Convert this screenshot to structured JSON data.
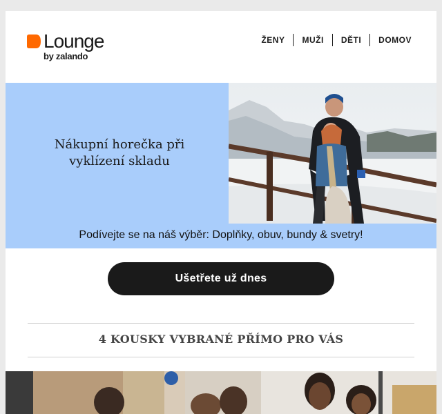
{
  "brand": {
    "name": "Lounge",
    "sub": "by zalando",
    "accent": "#ff6900"
  },
  "nav": {
    "items": [
      "ŽENY",
      "MUŽI",
      "DĚTI",
      "DOMOV"
    ]
  },
  "hero": {
    "headline": "Nákupní horečka při vyklízení skladu",
    "caption": "Podívejte se na náš výběr: Doplňky, obuv, bundy & svetry!",
    "background": "#a9cdfb"
  },
  "cta": {
    "label": "Ušetřete už dnes"
  },
  "section": {
    "title": "4 KOUSKY VYBRANÉ PŘÍMO PRO VÁS"
  }
}
